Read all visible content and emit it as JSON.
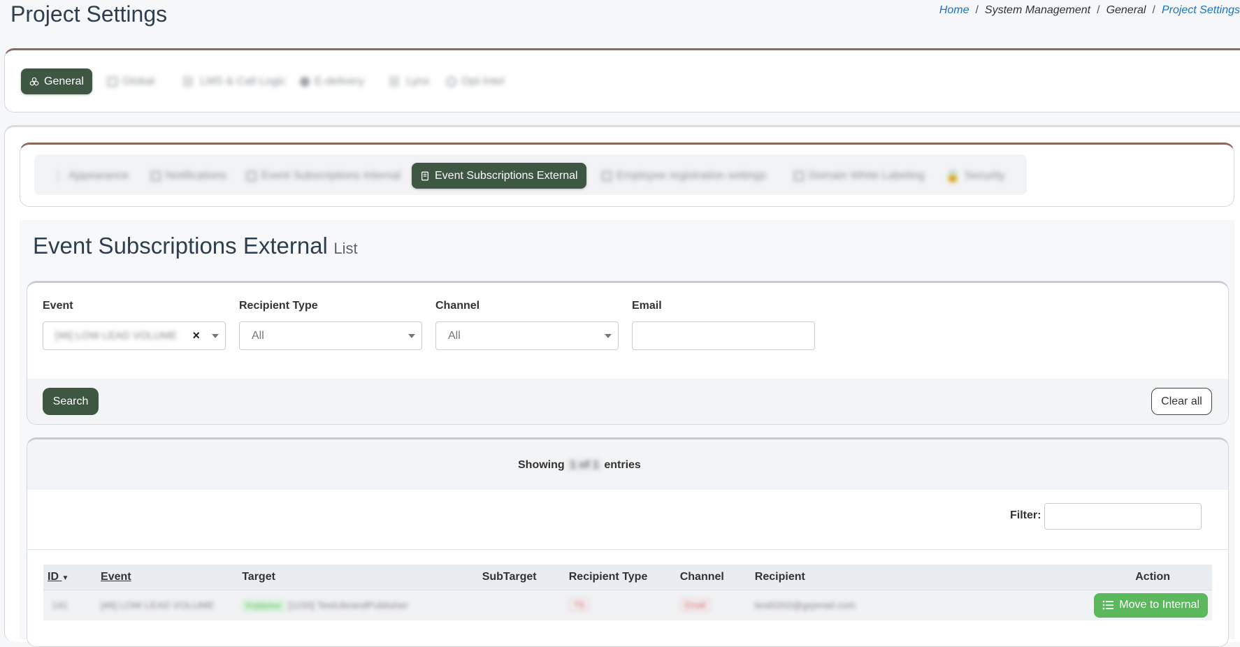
{
  "page": {
    "title": "Project Settings",
    "breadcrumb": [
      "Home",
      "System Management",
      "General",
      "Project Settings"
    ]
  },
  "main_tabs": [
    {
      "label": "General",
      "icon": "cubes-icon",
      "active": true
    },
    {
      "label": "Global",
      "icon": "grid-icon",
      "active": false
    },
    {
      "label": "LMS & Call Logic",
      "icon": "link-icon",
      "active": false
    },
    {
      "label": "E-delivery",
      "icon": "globe-icon",
      "active": false
    },
    {
      "label": "Lynx",
      "icon": "link-icon",
      "active": false
    },
    {
      "label": "Opt-Intel",
      "icon": "circle-icon",
      "active": false
    }
  ],
  "sub_tabs": [
    {
      "label": "Appearance",
      "icon": "pipe-icon",
      "active": false
    },
    {
      "label": "Notifications",
      "icon": "grid-icon",
      "active": false
    },
    {
      "label": "Event Subscriptions Internal",
      "icon": "grid-icon",
      "active": false
    },
    {
      "label": "Event Subscriptions External",
      "icon": "book-icon",
      "active": true
    },
    {
      "label": "Employee registration settings",
      "icon": "grid-icon",
      "active": false
    },
    {
      "label": "Domain White Labeling",
      "icon": "grid-icon",
      "active": false
    },
    {
      "label": "Security",
      "icon": "lock-icon",
      "active": false
    }
  ],
  "section": {
    "title": "Event Subscriptions External",
    "subtitle": "List"
  },
  "filters": {
    "event_label": "Event",
    "event_value": "[46] LOW LEAD VOLUME",
    "event_clear": "×",
    "recipient_type_label": "Recipient Type",
    "recipient_type_value": "All",
    "channel_label": "Channel",
    "channel_value": "All",
    "email_label": "Email",
    "email_value": "",
    "search_button": "Search",
    "clear_button": "Clear all"
  },
  "results": {
    "showing_prefix": "Showing",
    "showing_count": "1 of 1",
    "showing_suffix": "entries",
    "filter_label": "Filter:",
    "filter_value": ""
  },
  "table": {
    "columns": [
      "ID",
      "Event",
      "Target",
      "SubTarget",
      "Recipient Type",
      "Channel",
      "Recipient",
      "Action"
    ],
    "rows": [
      {
        "id": "141",
        "event": "[46] LOW LEAD VOLUME",
        "target_badge": "Publisher",
        "target": "[1150] TestUbrandPublisher",
        "subtarget": "",
        "recipient_type": "TS",
        "channel": "Email",
        "recipient": "test0202@grpmail.com",
        "action": "Move to Internal"
      }
    ]
  },
  "colors": {
    "primary": "#3d5742",
    "accent_border": "#8c6a5e",
    "link": "#1a73c8",
    "action_green": "#5cb85c"
  }
}
